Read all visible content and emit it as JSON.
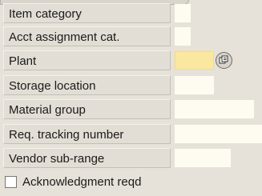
{
  "form": {
    "rows": [
      {
        "label": "Item category",
        "value": "",
        "required": false
      },
      {
        "label": "Acct assignment cat.",
        "value": "",
        "required": false
      },
      {
        "label": "Plant",
        "value": "",
        "required": true
      },
      {
        "label": "Storage location",
        "value": "",
        "required": false
      },
      {
        "label": "Material group",
        "value": "",
        "required": false
      },
      {
        "label": "Req. tracking number",
        "value": "",
        "required": false
      },
      {
        "label": "Vendor sub-range",
        "value": "",
        "required": false
      }
    ],
    "plant_help_icon": "value-help-icon",
    "acknowledgment": {
      "label": "Acknowledgment reqd",
      "checked": false
    }
  },
  "colors": {
    "background": "#e6e2d9",
    "field": "#fefcf1",
    "required_field": "#fbe8a0"
  }
}
